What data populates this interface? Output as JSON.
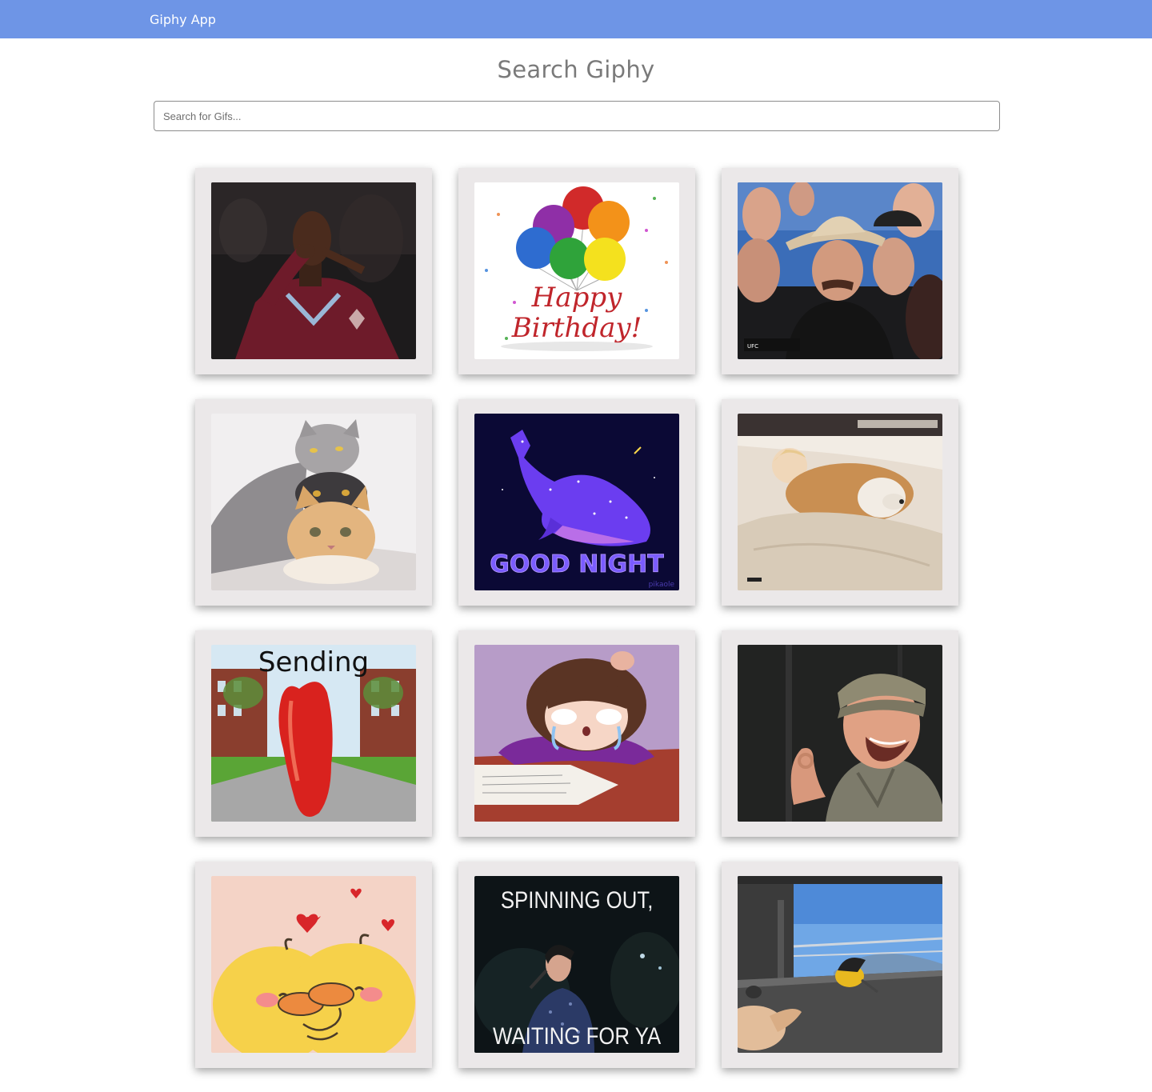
{
  "navbar": {
    "brand": "Giphy App"
  },
  "page": {
    "title": "Search Giphy"
  },
  "search": {
    "placeholder": "Search for Gifs...",
    "value": ""
  },
  "gifs": [
    {
      "name": "soccer-player-kiss-gif"
    },
    {
      "name": "happy-birthday-balloons-gif",
      "text": [
        "Happy",
        "Birthday!"
      ]
    },
    {
      "name": "cowboy-hat-crowd-gif"
    },
    {
      "name": "stacked-cats-gif"
    },
    {
      "name": "good-night-whale-gif",
      "text": [
        "GOOD NIGHT"
      ],
      "watermark": "pikaole"
    },
    {
      "name": "girl-hugging-dog-gif"
    },
    {
      "name": "sending-hugs-gif",
      "text": [
        "Sending"
      ]
    },
    {
      "name": "crying-anime-girl-gif"
    },
    {
      "name": "laughing-man-ok-gif"
    },
    {
      "name": "hugging-ducks-gif"
    },
    {
      "name": "spinning-out-singer-gif",
      "text": [
        "SPINNING OUT,",
        "WAITING FOR YA"
      ]
    },
    {
      "name": "bird-on-balcony-gif"
    }
  ],
  "colors": {
    "navbar": "#6e95e6",
    "card": "#ebe8e9",
    "title": "#7a7a7a"
  }
}
